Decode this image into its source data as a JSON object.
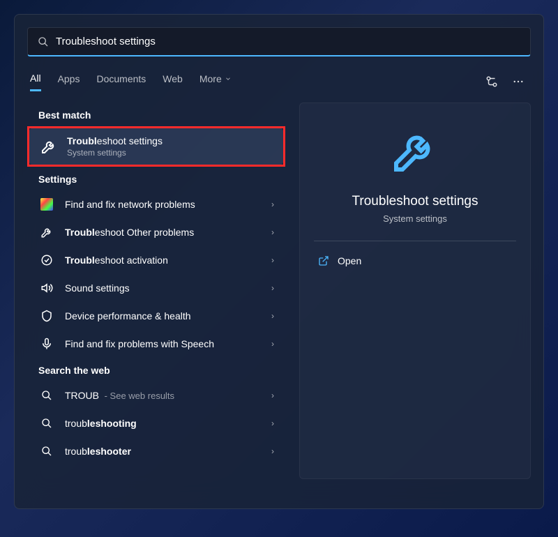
{
  "search": {
    "value": "Troubleshoot settings"
  },
  "tabs": {
    "all": "All",
    "apps": "Apps",
    "documents": "Documents",
    "web": "Web",
    "more": "More"
  },
  "sections": {
    "best_match": "Best match",
    "settings": "Settings",
    "web": "Search the web"
  },
  "best": {
    "title_bold": "Troubl",
    "title_rest": "eshoot settings",
    "subtitle": "System settings"
  },
  "settings_items": [
    {
      "label": "Find and fix network problems"
    },
    {
      "label_bold": "Troubl",
      "label_rest": "eshoot Other problems"
    },
    {
      "label_bold": "Troubl",
      "label_rest": "eshoot activation"
    },
    {
      "label": "Sound settings"
    },
    {
      "label": "Device performance & health"
    },
    {
      "label": "Find and fix problems with Speech"
    }
  ],
  "web_items": [
    {
      "label": "TROUB",
      "suffix": " - See web results"
    },
    {
      "prefix": "troub",
      "bold": "leshooting"
    },
    {
      "prefix": "troub",
      "bold": "leshooter"
    }
  ],
  "preview": {
    "title": "Troubleshoot settings",
    "subtitle": "System settings",
    "open": "Open"
  },
  "colors": {
    "accent": "#4db8ff",
    "highlight": "#ff2b2b"
  }
}
